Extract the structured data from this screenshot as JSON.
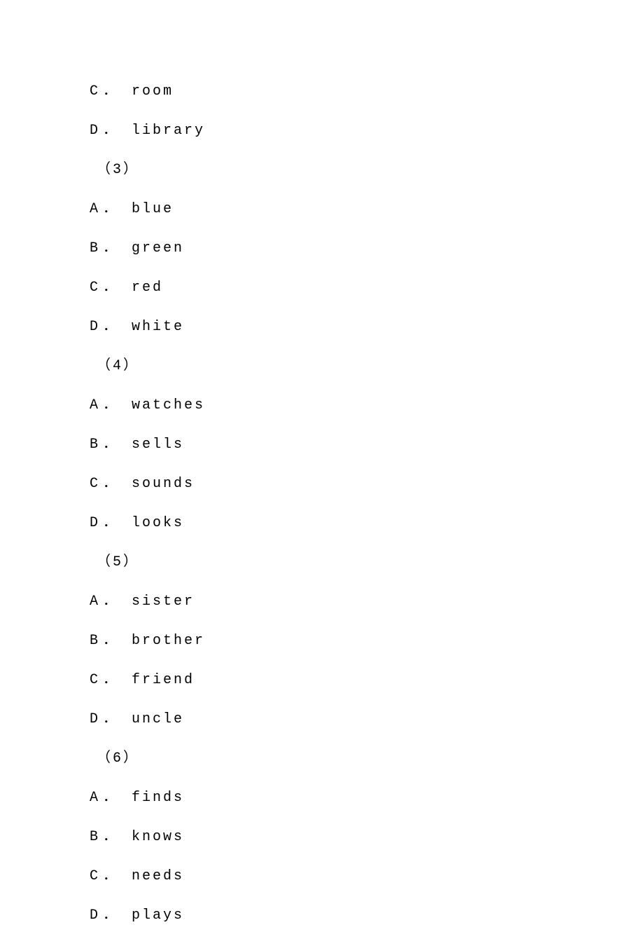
{
  "questions": [
    {
      "number": null,
      "options": [
        {
          "letter": "C",
          "word": "room"
        },
        {
          "letter": "D",
          "word": "library"
        }
      ]
    },
    {
      "number": "（3）",
      "options": [
        {
          "letter": "A",
          "word": "blue"
        },
        {
          "letter": "B",
          "word": "green"
        },
        {
          "letter": "C",
          "word": "red"
        },
        {
          "letter": "D",
          "word": "white"
        }
      ]
    },
    {
      "number": "（4）",
      "options": [
        {
          "letter": "A",
          "word": "watches"
        },
        {
          "letter": "B",
          "word": "sells"
        },
        {
          "letter": "C",
          "word": "sounds"
        },
        {
          "letter": "D",
          "word": "looks"
        }
      ]
    },
    {
      "number": "（5）",
      "options": [
        {
          "letter": "A",
          "word": "sister"
        },
        {
          "letter": "B",
          "word": "brother"
        },
        {
          "letter": "C",
          "word": "friend"
        },
        {
          "letter": "D",
          "word": "uncle"
        }
      ]
    },
    {
      "number": "（6）",
      "options": [
        {
          "letter": "A",
          "word": "finds"
        },
        {
          "letter": "B",
          "word": "knows"
        },
        {
          "letter": "C",
          "word": "needs"
        },
        {
          "letter": "D",
          "word": "plays"
        }
      ]
    }
  ]
}
